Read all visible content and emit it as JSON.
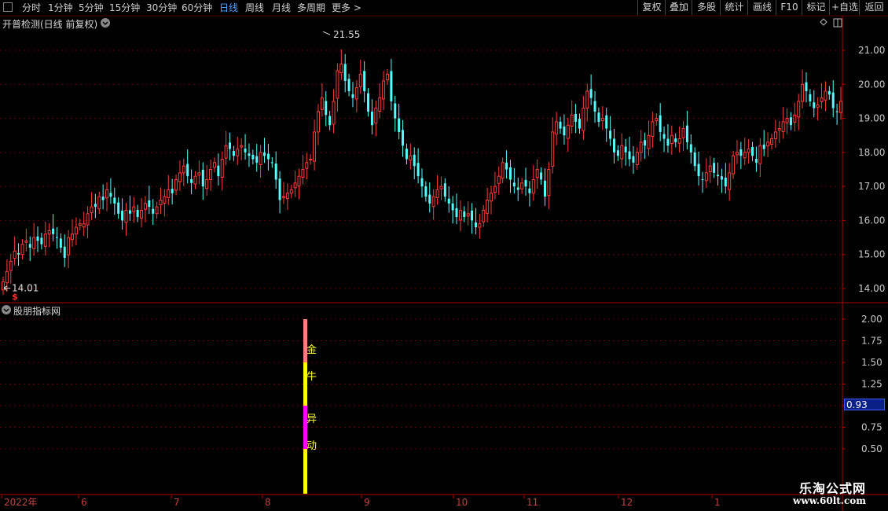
{
  "toolbar": {
    "periods": [
      "分时",
      "1分钟",
      "5分钟",
      "15分钟",
      "30分钟",
      "60分钟",
      "日线",
      "周线",
      "月线",
      "多周期",
      "更多 >"
    ],
    "active_period": "日线",
    "right_buttons": [
      "复权",
      "叠加",
      "多股",
      "统计",
      "画线",
      "F10",
      "标记",
      "+自选",
      "返回"
    ]
  },
  "main_panel": {
    "title": "开普检测(日线 前复权)",
    "max_label": "21.55",
    "min_label": "14.01",
    "signal_glyph": "$"
  },
  "indicator_panel": {
    "title": "股朋指标网",
    "current_value_label": "0.93",
    "bar_chars": [
      "金",
      "牛",
      "异",
      "动"
    ]
  },
  "x_axis": {
    "labels": [
      "2022年",
      "6",
      "7",
      "8",
      "9",
      "10",
      "11",
      "12",
      "1"
    ]
  },
  "watermark": {
    "line1": "乐淘公式网",
    "line2": "www.60lt.com"
  },
  "colors": {
    "up": "#ff3b3b",
    "down": "#54ffff",
    "axis": "#b00000",
    "grid": "#600000",
    "label": "#c8c8c8",
    "bar_pink": "#ff7d7d",
    "bar_yellow": "#ffff00",
    "bar_magenta": "#ff00ff"
  },
  "chart_data": [
    {
      "type": "candlestick",
      "title": "开普检测(日线 前复权)",
      "y_ticks": [
        14.0,
        15.0,
        16.0,
        17.0,
        18.0,
        19.0,
        20.0,
        21.0
      ],
      "ylim": [
        13.7,
        21.8
      ],
      "high_annotation": 21.55,
      "low_annotation": 14.01,
      "x_period_labels": [
        "2022年",
        "6",
        "7",
        "8",
        "9",
        "10",
        "11",
        "12",
        "1"
      ],
      "grid": true,
      "closes": [
        14.2,
        14.5,
        14.8,
        15.1,
        15.0,
        15.3,
        15.4,
        15.2,
        15.5,
        15.4,
        15.3,
        15.6,
        15.7,
        15.6,
        15.5,
        15.2,
        14.9,
        15.5,
        15.6,
        15.8,
        15.9,
        15.9,
        16.2,
        16.4,
        16.4,
        16.7,
        16.6,
        16.9,
        16.7,
        16.5,
        16.2,
        16.0,
        16.3,
        16.2,
        16.4,
        16.1,
        16.3,
        16.5,
        16.4,
        16.2,
        16.4,
        16.6,
        16.7,
        16.9,
        16.8,
        17.2,
        17.4,
        17.6,
        17.3,
        17.1,
        17.3,
        17.4,
        17.0,
        17.2,
        17.5,
        17.7,
        17.3,
        17.8,
        18.2,
        18.1,
        17.9,
        18.1,
        18.2,
        18.0,
        17.9,
        17.8,
        17.7,
        18.0,
        17.9,
        17.8,
        17.7,
        17.2,
        16.6,
        16.7,
        16.8,
        16.9,
        17.1,
        17.3,
        17.5,
        17.7,
        17.8,
        18.6,
        19.2,
        19.6,
        19.1,
        18.8,
        19.5,
        20.4,
        20.6,
        20.1,
        19.8,
        19.6,
        19.9,
        20.3,
        19.8,
        19.2,
        18.8,
        19.3,
        19.6,
        20.1,
        20.3,
        19.5,
        19.0,
        18.6,
        18.2,
        17.8,
        17.9,
        17.6,
        17.3,
        17.0,
        16.7,
        16.5,
        16.7,
        16.9,
        17.0,
        16.7,
        16.5,
        16.3,
        16.1,
        16.3,
        16.1,
        16.2,
        16.0,
        15.8,
        15.9,
        16.3,
        16.6,
        16.8,
        17.0,
        17.3,
        17.7,
        17.5,
        17.2,
        17.0,
        16.9,
        17.1,
        17.0,
        16.8,
        17.2,
        17.5,
        17.2,
        16.7,
        17.5,
        18.6,
        18.9,
        18.7,
        18.5,
        18.8,
        19.1,
        18.9,
        18.7,
        19.3,
        19.8,
        19.6,
        19.2,
        18.9,
        19.0,
        18.7,
        18.4,
        18.0,
        17.9,
        18.2,
        18.0,
        17.8,
        17.7,
        18.0,
        18.3,
        18.2,
        18.5,
        18.9,
        19.0,
        18.6,
        18.4,
        18.2,
        18.5,
        18.3,
        18.4,
        18.7,
        18.3,
        18.0,
        17.6,
        17.3,
        17.2,
        17.4,
        17.6,
        17.4,
        17.3,
        17.2,
        17.0,
        17.4,
        17.9,
        18.0,
        17.9,
        18.0,
        18.1,
        17.9,
        17.7,
        18.2,
        18.1,
        18.3,
        18.4,
        18.6,
        18.7,
        18.9,
        19.0,
        18.8,
        19.1,
        19.5,
        20.0,
        19.8,
        19.5,
        19.3,
        19.4,
        19.6,
        19.8,
        19.7,
        19.3,
        19.2,
        19.5
      ]
    },
    {
      "type": "bar",
      "title": "股朋指标网",
      "y_ticks": [
        0.5,
        0.75,
        1.0,
        1.25,
        1.5,
        1.75,
        2.0
      ],
      "ylim": [
        0,
        2.2
      ],
      "current_value": 0.93,
      "segments": [
        {
          "from": 1.5,
          "to": 2.0,
          "color": "#ff7d7d",
          "label": "金"
        },
        {
          "from": 1.0,
          "to": 1.5,
          "color": "#ffff00",
          "label": "牛"
        },
        {
          "from": 0.5,
          "to": 1.0,
          "color": "#ff00ff",
          "label": "异"
        },
        {
          "from": 0.0,
          "to": 0.5,
          "color": "#ffff00",
          "label": "动"
        }
      ]
    }
  ]
}
